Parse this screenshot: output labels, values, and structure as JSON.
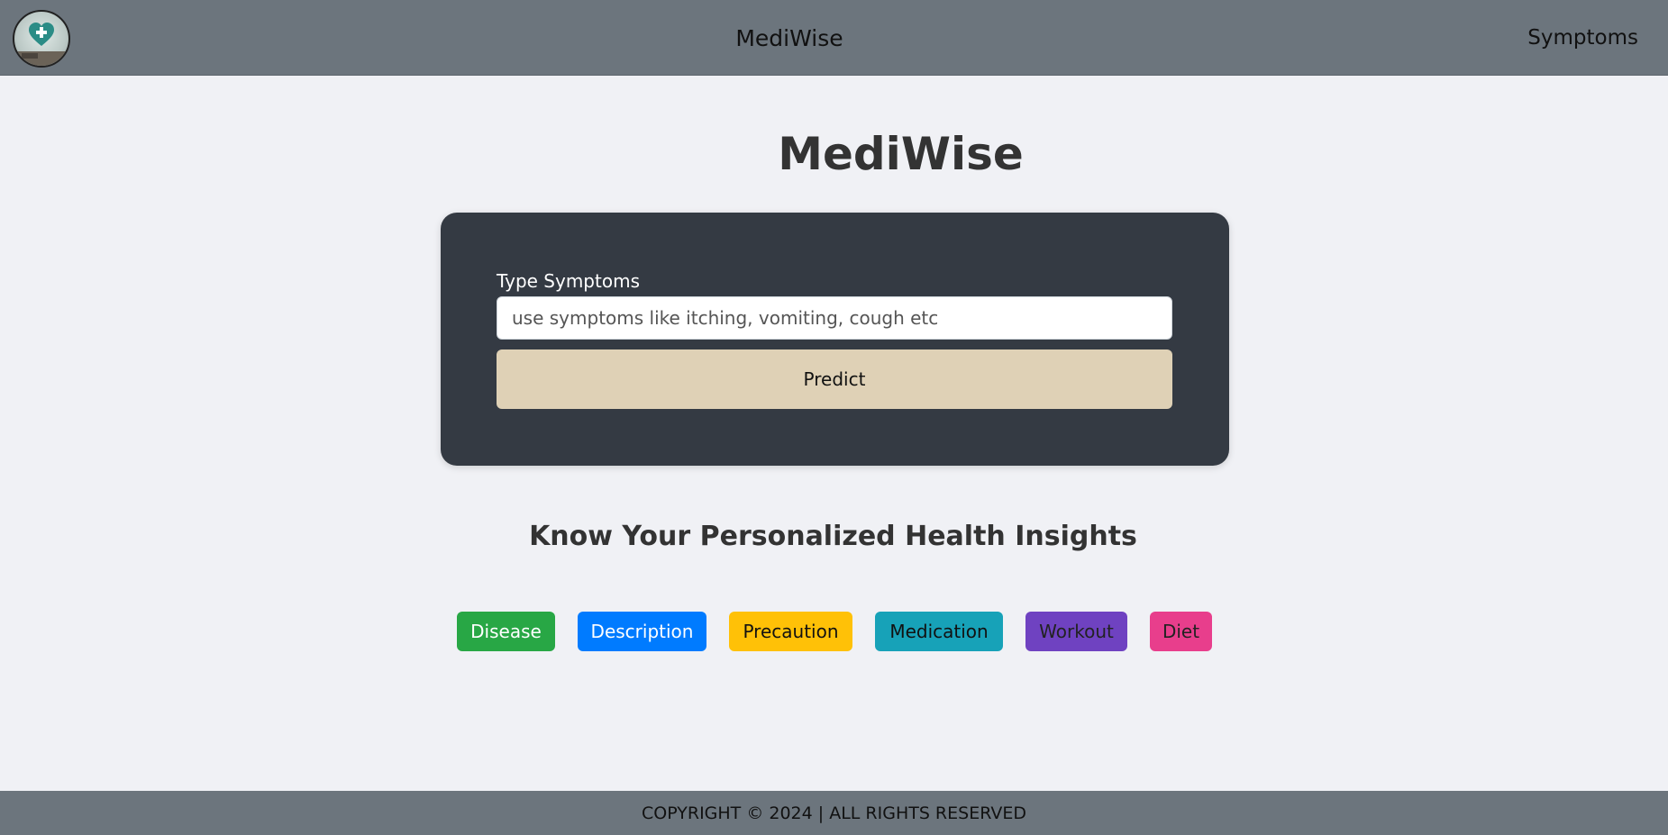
{
  "navbar": {
    "brand": "MediWise",
    "link": "Symptoms",
    "logo_icon": "heart-plus-icon"
  },
  "main": {
    "title": "MediWise",
    "form": {
      "label": "Type Symptoms",
      "placeholder": "use symptoms like itching, vomiting, cough etc",
      "value": "",
      "button": "Predict"
    },
    "subtitle": "Know Your Personalized Health Insights",
    "buttons": [
      {
        "label": "Disease",
        "bg": "#28a745",
        "fg": "#ffffff"
      },
      {
        "label": "Description",
        "bg": "#007bff",
        "fg": "#ffffff"
      },
      {
        "label": "Precaution",
        "bg": "#ffc107",
        "fg": "#111111"
      },
      {
        "label": "Medication",
        "bg": "#17a2b8",
        "fg": "#111111"
      },
      {
        "label": "Workout",
        "bg": "#6f42c1",
        "fg": "#222222"
      },
      {
        "label": "Diet",
        "bg": "#e83e8c",
        "fg": "#222222"
      }
    ]
  },
  "footer": {
    "text": "COPYRIGHT © 2024 | ALL RIGHTS RESERVED"
  },
  "colors": {
    "navbar_bg": "#6c757d",
    "page_bg": "#f0f1f5",
    "card_bg": "#343a43",
    "predict_bg": "#dfd1b6"
  }
}
